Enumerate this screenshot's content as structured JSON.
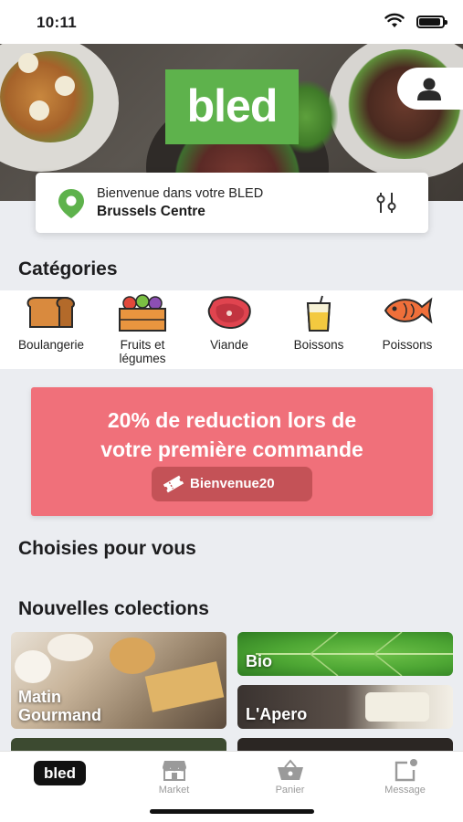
{
  "status_bar": {
    "time": "10:11"
  },
  "hero": {
    "logo_text": "bled"
  },
  "location": {
    "welcome": "Bienvenue dans votre BLED",
    "city": "Brussels Centre"
  },
  "categories": {
    "title": "Catégories",
    "items": [
      {
        "label": "Boulangerie",
        "icon": "bread-icon"
      },
      {
        "label": "Fruits et\nlégumes",
        "icon": "vegetable-crate-icon"
      },
      {
        "label": "Viande",
        "icon": "steak-icon"
      },
      {
        "label": "Boissons",
        "icon": "drink-icon"
      },
      {
        "label": "Poissons",
        "icon": "fish-icon"
      }
    ]
  },
  "promo": {
    "line1": "20% de reduction lors de",
    "line2": "votre première commande",
    "code": "Bienvenue20",
    "color": "#f0707a"
  },
  "chosen": {
    "title": "Choisies pour vous"
  },
  "collections": {
    "title": "Nouvelles colections",
    "items": [
      {
        "name": "Matin\nGourmand"
      },
      {
        "name": "Bio"
      },
      {
        "name": "L'Apero"
      }
    ]
  },
  "tabbar": {
    "home_badge": "bled",
    "items": [
      {
        "label": "Market",
        "icon": "market-icon"
      },
      {
        "label": "Panier",
        "icon": "basket-icon"
      },
      {
        "label": "Message",
        "icon": "message-icon"
      }
    ]
  },
  "colors": {
    "brand_green": "#5eb24c",
    "promo_red": "#f0707a",
    "code_bg": "#c45257"
  }
}
